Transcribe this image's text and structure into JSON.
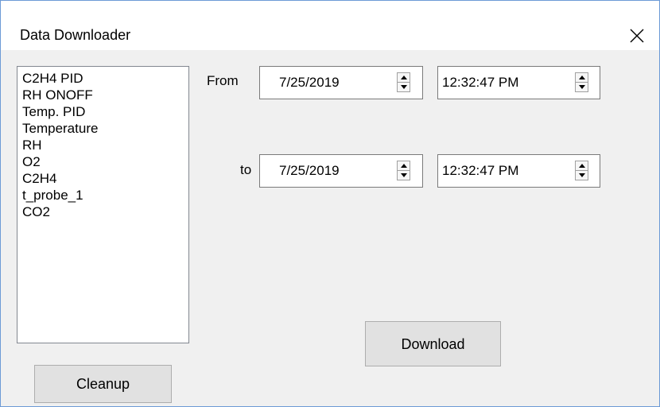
{
  "window": {
    "title": "Data Downloader",
    "close_icon": "close-icon"
  },
  "channels": {
    "items": [
      "C2H4 PID",
      "RH ONOFF",
      "Temp. PID",
      "Temperature",
      "RH",
      "O2",
      "C2H4",
      "t_probe_1",
      "CO2"
    ]
  },
  "range": {
    "from_label": "From",
    "to_label": "to",
    "from_date": "7/25/2019",
    "from_time": "12:32:47 PM",
    "to_date": "7/25/2019",
    "to_time": "12:32:47 PM"
  },
  "buttons": {
    "download": "Download",
    "cleanup": "Cleanup"
  },
  "colors": {
    "window_border": "#6c9ad6",
    "dialog_background": "#f0f0f0",
    "button_face": "#e1e1e1"
  }
}
